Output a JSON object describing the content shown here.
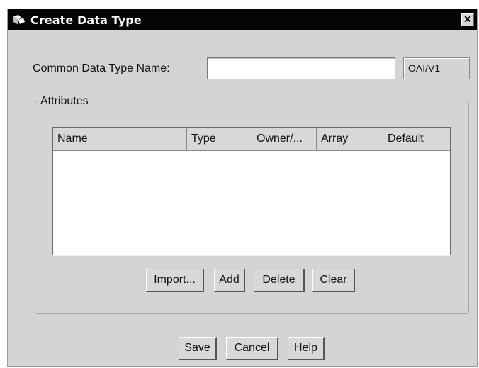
{
  "window": {
    "title": "Create Data Type",
    "close_glyph": "✕"
  },
  "form": {
    "name_label": "Common Data Type Name:",
    "name_value": "",
    "version": "OAI/V1"
  },
  "attributes": {
    "group_label": "Attributes",
    "columns": [
      "Name",
      "Type",
      "Owner/...",
      "Array",
      "Default"
    ],
    "rows": []
  },
  "attr_buttons": {
    "import": "Import...",
    "add": "Add",
    "delete": "Delete",
    "clear": "Clear"
  },
  "dialog_buttons": {
    "save": "Save",
    "cancel": "Cancel",
    "help": "Help"
  }
}
